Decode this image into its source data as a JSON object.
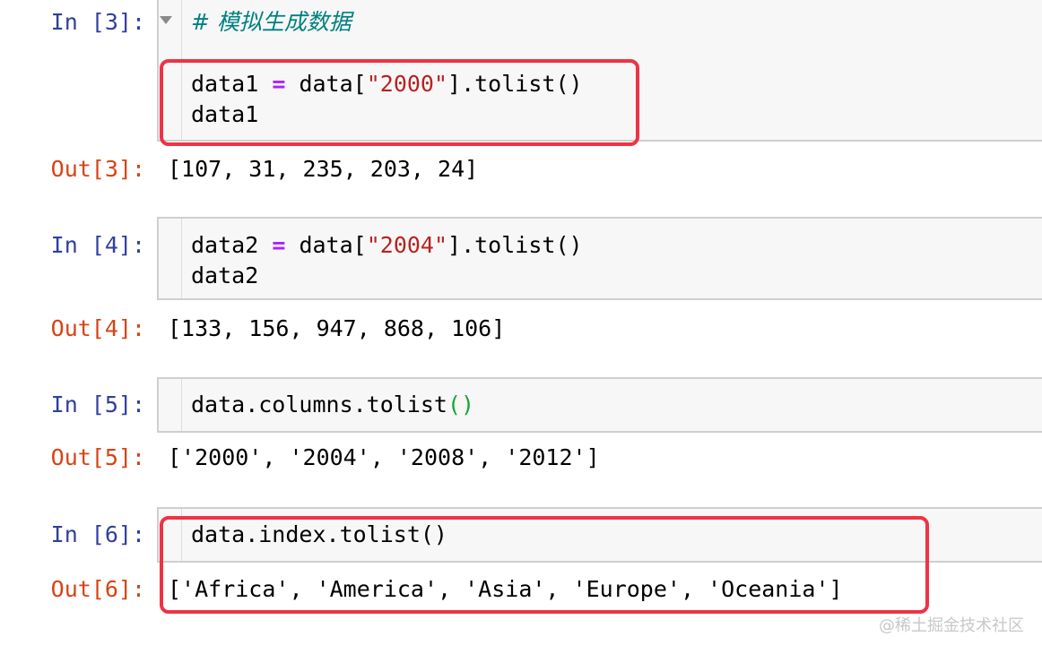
{
  "cells": [
    {
      "in_prompt": "In [3]:",
      "comment": "# 模拟生成数据",
      "code_lines": [
        {
          "var": "data1",
          "op": "=",
          "pre": "data[",
          "str": "\"2000\"",
          "post": "].tolist()"
        },
        {
          "plain": "data1"
        }
      ],
      "out_prompt": "Out[3]:",
      "output": "[107, 31, 235, 203, 24]"
    },
    {
      "in_prompt": "In [4]:",
      "code_lines": [
        {
          "var": "data2",
          "op": "=",
          "pre": "data[",
          "str": "\"2004\"",
          "post": "].tolist()"
        },
        {
          "plain": "data2"
        }
      ],
      "out_prompt": "Out[4]:",
      "output": "[133, 156, 947, 868, 106]"
    },
    {
      "in_prompt": "In [5]:",
      "code": "data.columns.tolist",
      "code_parens": "()",
      "out_prompt": "Out[5]:",
      "output": "['2000', '2004', '2008', '2012']"
    },
    {
      "in_prompt": "In [6]:",
      "code": "data.index.tolist()",
      "out_prompt": "Out[6]:",
      "output": "['Africa', 'America', 'Asia', 'Europe', 'Oceania']"
    }
  ],
  "watermark": "@稀土掘金技术社区",
  "colors": {
    "in_prompt": "#303f9f",
    "out_prompt": "#d84315",
    "highlight": "#ee3344",
    "comment": "#008080",
    "string": "#ba2121",
    "operator": "#aa22ff"
  }
}
